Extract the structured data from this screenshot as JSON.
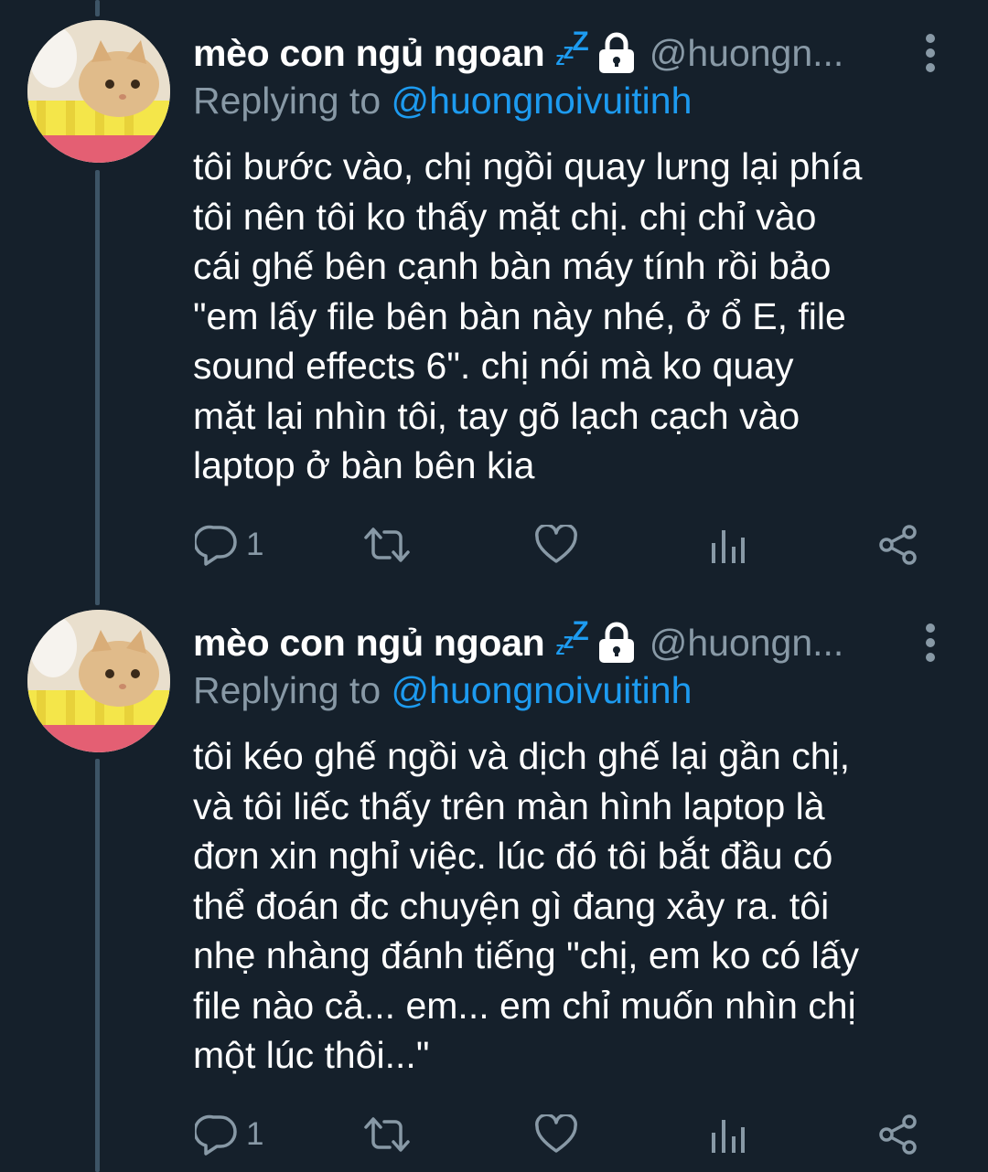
{
  "tweets": [
    {
      "author_name": "mèo con ngủ ngoan",
      "zzz": [
        "z",
        "z",
        "Z"
      ],
      "handle": "@huongn...",
      "replying_prefix": "Replying to",
      "replying_to": "@huongnoivuitinh",
      "text_lines": [
        "tôi bước vào, chị ngồi quay lưng lại phía",
        "tôi nên tôi ko thấy mặt chị. chị chỉ vào",
        "cái ghế bên cạnh bàn máy tính rồi bảo",
        "\"em lấy file bên bàn này nhé, ở ổ E, file",
        "sound effects 6\". chị nói mà ko quay",
        "mặt lại nhìn tôi, tay gõ lạch cạch vào",
        "laptop ở bàn bên kia"
      ],
      "reply_count": "1"
    },
    {
      "author_name": "mèo con ngủ ngoan",
      "zzz": [
        "z",
        "z",
        "Z"
      ],
      "handle": "@huongn...",
      "replying_prefix": "Replying to",
      "replying_to": "@huongnoivuitinh",
      "text_lines": [
        "tôi kéo ghế ngồi và dịch ghế lại gần chị,",
        "và tôi liếc thấy trên màn hình laptop là",
        "đơn xin nghỉ việc. lúc đó tôi bắt đầu có",
        "thể đoán đc chuyện gì đang xảy ra. tôi",
        "nhẹ nhàng đánh tiếng \"chị, em ko có lấy",
        "file nào cả... em... em chỉ muốn nhìn chị",
        "một lúc thôi...\""
      ],
      "reply_count": "1"
    }
  ],
  "icons": {
    "reply": "reply-icon",
    "retweet": "retweet-icon",
    "like": "heart-icon",
    "analytics": "analytics-icon",
    "share": "share-icon",
    "lock": "lock-icon",
    "more": "more-vertical-icon"
  },
  "colors": {
    "background": "#15202b",
    "text": "#ffffff",
    "secondary": "#8899a6",
    "accent": "#1d9bf0",
    "thread_line": "#3d5466"
  }
}
